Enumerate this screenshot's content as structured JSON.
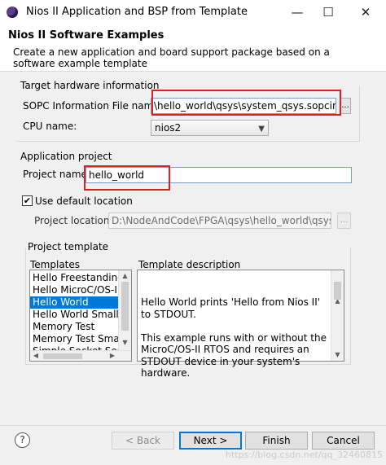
{
  "window": {
    "title": "Nios II Application and BSP from Template",
    "minimize": "—",
    "maximize": "☐",
    "close": "✕"
  },
  "header": {
    "title": "Nios II Software Examples",
    "description": "Create a new application and board support package based on a software example template"
  },
  "target_hardware": {
    "section_title": "Target hardware information",
    "sopc_label": "SOPC Information File name:",
    "sopc_value": "\\hello_world\\qsys\\system_qsys.sopcinfo",
    "browse_label": "...",
    "cpu_label": "CPU name:",
    "cpu_value": "nios2"
  },
  "application_project": {
    "section_title": "Application project",
    "project_name_label": "Project name:",
    "project_name_value": "hello_world",
    "use_default_label": "Use default location",
    "use_default_checked": true,
    "project_location_label": "Project location:",
    "project_location_value": "D:\\NodeAndCode\\FPGA\\qsys\\hello_world\\qsys\\sc",
    "browse_label": "..."
  },
  "project_template": {
    "section_title": "Project template",
    "templates_label": "Templates",
    "description_label": "Template description",
    "templates": [
      "Hello Freestanding",
      "Hello MicroC/OS-II",
      "Hello World",
      "Hello World Small",
      "Memory Test",
      "Memory Test Small",
      "Simple Socket Serv"
    ],
    "selected_template": "Hello World",
    "description": "Hello World prints 'Hello from Nios II' to STDOUT.\n\nThis example runs with or without the MicroC/OS-II RTOS and requires an STDOUT device in your system's hardware."
  },
  "footer": {
    "help_label": "?",
    "back_label": "< Back",
    "next_label": "Next >",
    "finish_label": "Finish",
    "cancel_label": "Cancel",
    "watermark": "https://blog.csdn.net/qq_32460815"
  },
  "colors": {
    "selection": "#0078d7",
    "highlight_box": "#e02020"
  }
}
